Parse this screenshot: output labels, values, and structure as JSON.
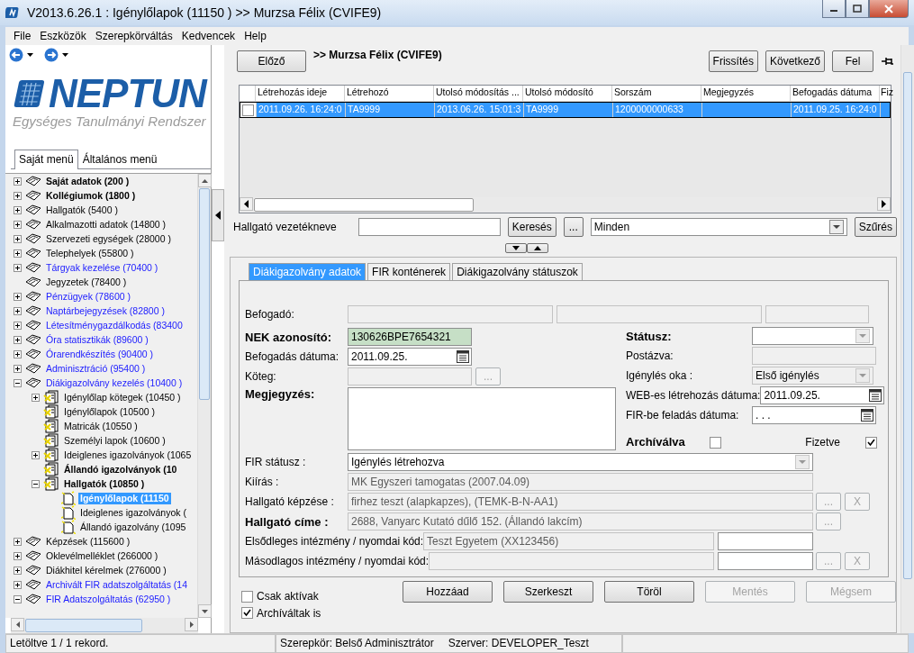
{
  "window": {
    "title": "V2013.6.26.1 : Igénylőlapok (11150 ) >> Murzsa Félix (CVIFE9)"
  },
  "menu": [
    "File",
    "Eszközök",
    "Szerepkörváltás",
    "Kedvencek",
    "Help"
  ],
  "logo": {
    "name": "NEPTUN",
    "tagline": "Egységes Tanulmányi Rendszer"
  },
  "menu_tabs": [
    {
      "label": "Saját menü",
      "selected": true
    },
    {
      "label": "Általános menü",
      "selected": false
    }
  ],
  "tree": [
    {
      "label": "Saját adatok (200 )",
      "kind": "book",
      "expandable": true,
      "expanded": false,
      "bold": true,
      "selected": false,
      "highlighted": false
    },
    {
      "label": "Kollégiumok (1800 )",
      "kind": "book",
      "expandable": true,
      "expanded": false,
      "bold": true,
      "selected": false,
      "highlighted": false
    },
    {
      "label": "Hallgatók (5400 )",
      "kind": "book",
      "expandable": true,
      "expanded": false,
      "bold": false,
      "selected": false,
      "highlighted": false
    },
    {
      "label": "Alkalmazotti adatok (14800 )",
      "kind": "book",
      "expandable": true,
      "expanded": false,
      "bold": false,
      "selected": false,
      "highlighted": false
    },
    {
      "label": "Szervezeti egységek (28000 )",
      "kind": "book",
      "expandable": true,
      "expanded": false,
      "bold": false,
      "selected": false,
      "highlighted": false
    },
    {
      "label": "Telephelyek (55800 )",
      "kind": "book",
      "expandable": true,
      "expanded": false,
      "bold": false,
      "selected": false,
      "highlighted": false
    },
    {
      "label": "Tárgyak kezelése (70400 )",
      "kind": "book",
      "expandable": true,
      "expanded": false,
      "bold": false,
      "selected": false,
      "highlighted": true
    },
    {
      "label": "Jegyzetek (78400 )",
      "kind": "book",
      "expandable": false,
      "bold": false,
      "selected": false,
      "highlighted": false
    },
    {
      "label": "Pénzügyek (78600 )",
      "kind": "book",
      "expandable": true,
      "expanded": false,
      "bold": false,
      "selected": false,
      "highlighted": true
    },
    {
      "label": "Naptárbejegyzések (82800 )",
      "kind": "book",
      "expandable": true,
      "expanded": false,
      "bold": false,
      "selected": false,
      "highlighted": true
    },
    {
      "label": "Létesítménygazdálkodás (83400",
      "kind": "book",
      "expandable": true,
      "expanded": false,
      "bold": false,
      "selected": false,
      "highlighted": true
    },
    {
      "label": "Óra statisztikák (89600 )",
      "kind": "book",
      "expandable": true,
      "expanded": false,
      "bold": false,
      "selected": false,
      "highlighted": true
    },
    {
      "label": "Órarendkészítés (90400 )",
      "kind": "book",
      "expandable": true,
      "expanded": false,
      "bold": false,
      "selected": false,
      "highlighted": true
    },
    {
      "label": "Adminisztráció (95400 )",
      "kind": "book",
      "expandable": true,
      "expanded": false,
      "bold": false,
      "selected": false,
      "highlighted": true
    },
    {
      "label": "Diákigazolvány kezelés (10400 )",
      "kind": "book",
      "expandable": true,
      "expanded": true,
      "bold": false,
      "selected": false,
      "highlighted": true,
      "children": [
        {
          "label": "Igénylőlap kötegek (10450 )",
          "kind": "stack",
          "expandable": true,
          "expanded": false,
          "bold": false,
          "selected": false,
          "highlighted": false
        },
        {
          "label": "Igénylőlapok (10500 )",
          "kind": "stack",
          "expandable": false,
          "bold": false,
          "selected": false,
          "highlighted": false
        },
        {
          "label": "Matricák (10550 )",
          "kind": "stack",
          "expandable": false,
          "bold": false,
          "selected": false,
          "highlighted": false
        },
        {
          "label": "Személyi lapok (10600 )",
          "kind": "stack",
          "expandable": false,
          "bold": false,
          "selected": false,
          "highlighted": false
        },
        {
          "label": "Ideiglenes igazolványok (1065",
          "kind": "stack",
          "expandable": true,
          "expanded": false,
          "bold": false,
          "selected": false,
          "highlighted": false
        },
        {
          "label": "Állandó igazolványok (10",
          "kind": "stack",
          "expandable": false,
          "bold": true,
          "selected": false,
          "highlighted": false
        },
        {
          "label": "Hallgatók (10850 )",
          "kind": "stack",
          "expandable": true,
          "expanded": true,
          "bold": true,
          "selected": false,
          "highlighted": false,
          "children": [
            {
              "label": "Igénylőlapok (11150",
              "kind": "page",
              "expandable": false,
              "bold": true,
              "selected": true
            },
            {
              "label": "Ideiglenes igazolványok (",
              "kind": "page",
              "expandable": false,
              "bold": false,
              "selected": false,
              "highlighted": false
            },
            {
              "label": "Állandó igazolvány (1095",
              "kind": "page",
              "expandable": false,
              "bold": false,
              "selected": false,
              "highlighted": false
            }
          ]
        }
      ]
    },
    {
      "label": "Képzések (115600 )",
      "kind": "book",
      "expandable": true,
      "expanded": false,
      "bold": false,
      "selected": false,
      "highlighted": false
    },
    {
      "label": "Oklevélmelléklet (266000 )",
      "kind": "book",
      "expandable": true,
      "expanded": false,
      "bold": false,
      "selected": false,
      "highlighted": false
    },
    {
      "label": "Diákhitel kérelmek (276000 )",
      "kind": "book",
      "expandable": true,
      "expanded": false,
      "bold": false,
      "selected": false,
      "highlighted": false
    },
    {
      "label": "Archivált FIR adatszolgáltatás (14",
      "kind": "book",
      "expandable": true,
      "expanded": false,
      "bold": false,
      "selected": false,
      "highlighted": true
    },
    {
      "label": "FIR Adatszolgáltatás (62950 )",
      "kind": "book",
      "expandable": true,
      "expanded": true,
      "bold": false,
      "selected": false,
      "highlighted": true
    }
  ],
  "toolbar": {
    "prev": "Előző",
    "header": ">> Murzsa Félix (CVIFE9)",
    "buttons": [
      "Frissítés",
      "Következő",
      "Fel"
    ]
  },
  "grid": {
    "columns": [
      "Létrehozás ideje",
      "Létrehozó",
      "Utolsó módosítás ...",
      "Utolsó módosító",
      "Sorszám",
      "Megjegyzés",
      "Befogadás dátuma",
      "Fiz"
    ],
    "rows": [
      {
        "selected": true,
        "checked": false,
        "cells": [
          "2011.09.26. 16:24:0",
          "TA9999",
          "2013.06.26. 15:01:3",
          "TA9999",
          "1200000000633",
          null,
          "2011.09.25. 16:24:0",
          null
        ]
      }
    ]
  },
  "filter": {
    "label": "Hallgató vezetékneve",
    "search_button": "Keresés",
    "more_button": "...",
    "select_value": "Minden",
    "filter_button": "Szűrés"
  },
  "form": {
    "tabs": [
      {
        "label": "Diákigazolvány adatok",
        "selected": true
      },
      {
        "label": "FIR konténerek",
        "selected": false
      },
      {
        "label": "Diákigazolvány státuszok",
        "selected": false
      }
    ],
    "top_row": {
      "label": "Befogadó:",
      "bold": false,
      "inputs": [
        {
          "kind": "text",
          "disabled": true
        },
        {
          "kind": "text",
          "disabled": true
        },
        {
          "kind": "small",
          "disabled": true
        }
      ]
    },
    "left": [
      {
        "label": "NEK azonosító:",
        "bold": true,
        "inputs": [
          {
            "kind": "code",
            "value": "130626BPE7654321",
            "disabled": false
          }
        ]
      },
      {
        "label": "Befogadás dátuma:",
        "bold": false,
        "inputs": [
          {
            "kind": "date",
            "value": "2011.09.25.",
            "disabled": false
          }
        ]
      },
      {
        "label": "Köteg:",
        "bold": false,
        "inputs": [
          {
            "kind": "text",
            "disabled": true
          },
          {
            "kind": "button",
            "label": "...",
            "disabled": true
          }
        ]
      },
      {
        "label": "Megjegyzés:",
        "bold": true,
        "inputs": [
          {
            "kind": "textarea"
          }
        ]
      }
    ],
    "right": [
      {
        "label": "Státusz:",
        "bold": true,
        "inputs": [
          {
            "kind": "select",
            "disabled": false
          }
        ]
      },
      {
        "label": "Postázva:",
        "bold": false,
        "inputs": [
          {
            "kind": "text",
            "disabled": true
          }
        ]
      },
      {
        "label": "Igénylés oka :",
        "bold": false,
        "inputs": [
          {
            "kind": "select",
            "value": "Első igénylés",
            "disabled": true
          }
        ]
      },
      {
        "label": "WEB-es létrehozás dátuma:",
        "bold": false,
        "inputs": [
          {
            "kind": "date",
            "value": "2011.09.25.",
            "disabled": false
          }
        ]
      },
      {
        "label": "FIR-be feladás dátuma:",
        "bold": false,
        "inputs": [
          {
            "kind": "date",
            "value": ". . .",
            "disabled": false
          }
        ]
      },
      {
        "label": "Archíválva",
        "bold": true,
        "inputs": [
          {
            "kind": "check",
            "checked": false
          },
          {
            "kind": "caption",
            "label": "Fizetve"
          },
          {
            "kind": "check",
            "checked": true
          }
        ]
      }
    ],
    "rows": [
      {
        "label": "FIR státusz :",
        "bold": false,
        "inputs": [
          {
            "kind": "select",
            "value": "Igénylés létrehozva",
            "disabled": false
          }
        ],
        "buttons": []
      },
      {
        "label": "Kiírás :",
        "bold": false,
        "inputs": [
          {
            "kind": "text",
            "value": "MK Egyszeri tamogatas (2007.04.09)",
            "disabled": true
          }
        ],
        "buttons": []
      },
      {
        "label": "Hallgató képzése :",
        "bold": false,
        "inputs": [
          {
            "kind": "text",
            "value": "firhez teszt (alapkapzes), (TEMK-B-N-AA1)",
            "disabled": true
          }
        ],
        "buttons": [
          {
            "label": "...",
            "disabled": true
          },
          {
            "label": "X",
            "disabled": true
          }
        ]
      },
      {
        "label": "Hallgató címe :",
        "bold": true,
        "inputs": [
          {
            "kind": "text",
            "value": "2688, Vanyarc Kutató dűlő 152. (Állandó lakcím)",
            "disabled": true
          }
        ],
        "buttons": [
          {
            "label": "...",
            "disabled": true
          }
        ]
      },
      {
        "label": "Elsődleges intézmény / nyomdai kód:",
        "bold": false,
        "inputs": [
          {
            "kind": "text",
            "value": "Teszt Egyetem (XX123456)",
            "disabled": true
          },
          {
            "kind": "small",
            "disabled": false
          }
        ],
        "buttons": []
      },
      {
        "label": "Másodlagos intézmény / nyomdai kód:",
        "bold": false,
        "inputs": [
          {
            "kind": "text",
            "disabled": true
          },
          {
            "kind": "small",
            "disabled": false
          }
        ],
        "buttons": [
          {
            "label": "...",
            "disabled": true
          },
          {
            "label": "X",
            "disabled": true
          }
        ]
      }
    ]
  },
  "checkboxes": [
    {
      "label": "Csak aktívak",
      "checked": false
    },
    {
      "label": "Archíváltak is",
      "checked": true
    }
  ],
  "actions": [
    {
      "label": "Hozzáad",
      "disabled": false
    },
    {
      "label": "Szerkeszt",
      "disabled": false
    },
    {
      "label": "Töröl",
      "disabled": false
    },
    {
      "label": "Mentés",
      "disabled": true
    },
    {
      "label": "Mégsem",
      "disabled": true
    }
  ],
  "status_bar": [
    "Letöltve 1 / 1 rekord.",
    "Szerepkör: Belső Adminisztrátor",
    "Szerver: DEVELOPER_Teszt"
  ]
}
